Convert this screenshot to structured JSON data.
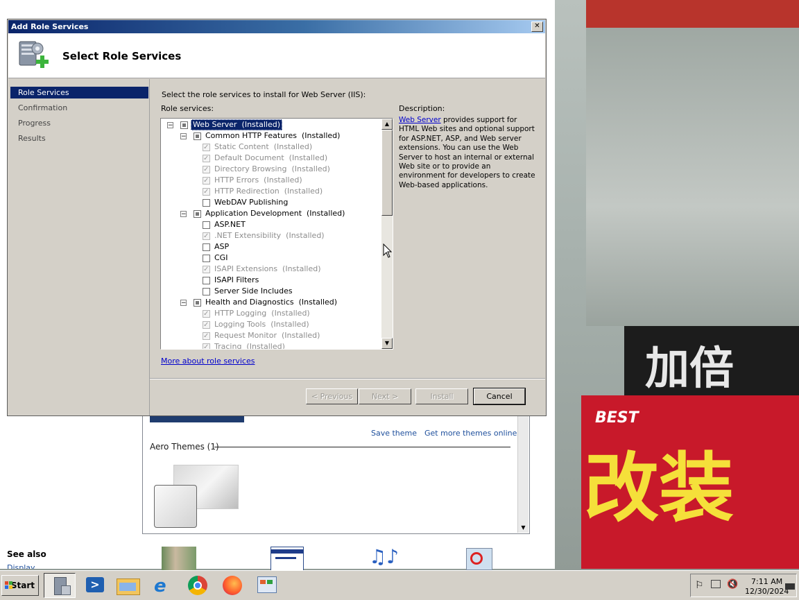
{
  "dialog": {
    "title": "Add Role Services",
    "close": "✕",
    "header_title": "Select Role Services",
    "nav": [
      "Role Services",
      "Confirmation",
      "Progress",
      "Results"
    ],
    "instruction": "Select the role services to install for Web Server (IIS):",
    "role_services_label": "Role services:",
    "description_label": "Description:",
    "description_link": "Web Server",
    "description_text": " provides support for HTML Web sites and optional support for ASP.NET, ASP, and Web server extensions. You can use the Web Server to host an internal or external Web site or to provide an environment for developers to create Web-based applications.",
    "more_link": "More about role services",
    "buttons": {
      "previous": "< Previous",
      "next": "Next >",
      "install": "Install",
      "cancel": "Cancel"
    },
    "tree": [
      {
        "label": "Web Server  (Installed)",
        "level": 0,
        "expander": "−",
        "state": "partial",
        "style": "sel"
      },
      {
        "label": "Common HTTP Features  (Installed)",
        "level": 1,
        "expander": "−",
        "state": "partial",
        "style": ""
      },
      {
        "label": "Static Content  (Installed)",
        "level": 2,
        "state": "checked",
        "style": "dim"
      },
      {
        "label": "Default Document  (Installed)",
        "level": 2,
        "state": "checked",
        "style": "dim"
      },
      {
        "label": "Directory Browsing  (Installed)",
        "level": 2,
        "state": "checked",
        "style": "dim"
      },
      {
        "label": "HTTP Errors  (Installed)",
        "level": 2,
        "state": "checked",
        "style": "dim"
      },
      {
        "label": "HTTP Redirection  (Installed)",
        "level": 2,
        "state": "checked",
        "style": "dim"
      },
      {
        "label": "WebDAV Publishing",
        "level": 2,
        "state": "unchecked",
        "style": ""
      },
      {
        "label": "Application Development  (Installed)",
        "level": 1,
        "expander": "−",
        "state": "partial",
        "style": ""
      },
      {
        "label": "ASP.NET",
        "level": 2,
        "state": "unchecked",
        "style": ""
      },
      {
        "label": ".NET Extensibility  (Installed)",
        "level": 2,
        "state": "checked",
        "style": "dim"
      },
      {
        "label": "ASP",
        "level": 2,
        "state": "unchecked",
        "style": ""
      },
      {
        "label": "CGI",
        "level": 2,
        "state": "unchecked",
        "style": ""
      },
      {
        "label": "ISAPI Extensions  (Installed)",
        "level": 2,
        "state": "checked",
        "style": "dim"
      },
      {
        "label": "ISAPI Filters",
        "level": 2,
        "state": "unchecked",
        "style": ""
      },
      {
        "label": "Server Side Includes",
        "level": 2,
        "state": "unchecked",
        "style": ""
      },
      {
        "label": "Health and Diagnostics  (Installed)",
        "level": 1,
        "expander": "−",
        "state": "partial",
        "style": ""
      },
      {
        "label": "HTTP Logging  (Installed)",
        "level": 2,
        "state": "checked",
        "style": "dim"
      },
      {
        "label": "Logging Tools  (Installed)",
        "level": 2,
        "state": "checked",
        "style": "dim"
      },
      {
        "label": "Request Monitor  (Installed)",
        "level": 2,
        "state": "checked",
        "style": "dim"
      },
      {
        "label": "Tracing  (Installed)",
        "level": 2,
        "state": "checked",
        "style": "dim"
      }
    ]
  },
  "background_window": {
    "save_theme": "Save theme",
    "more_themes": "Get more themes online",
    "aero_themes": "Aero Themes (1)",
    "see_also": "See also",
    "see_also_display": "Display"
  },
  "taskbar": {
    "start_label": "Start",
    "apps": [
      "server-manager-icon",
      "powershell-icon",
      "explorer-folder-icon",
      "internet-explorer-icon",
      "chrome-icon",
      "firefox-icon",
      "control-panel-icon"
    ],
    "clock_time": "7:11 AM",
    "clock_date": "12/30/2024"
  },
  "wallpaper_text": [
    "加倍",
    "改装",
    "BEST"
  ]
}
